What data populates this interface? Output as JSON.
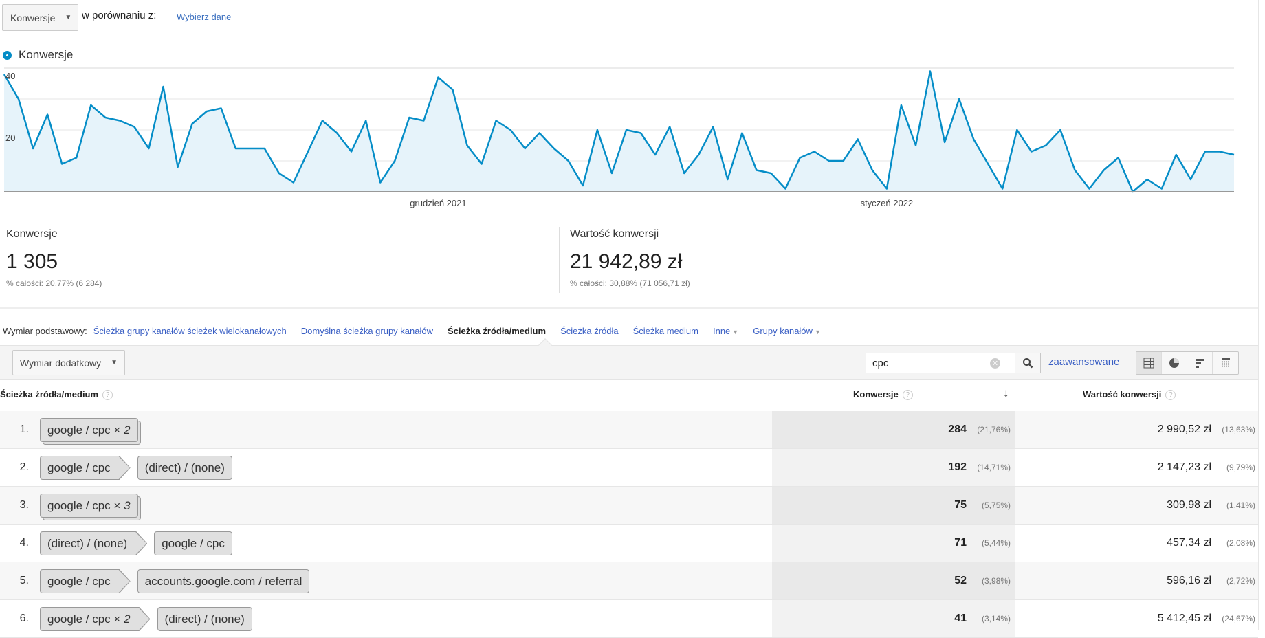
{
  "top": {
    "metric_dropdown": "Konwersje",
    "compare_label": "w porównaniu z:",
    "compare_link": "Wybierz dane"
  },
  "legend": {
    "label": "Konwersje",
    "color": "#058dc7"
  },
  "chart_data": {
    "type": "area",
    "series": [
      {
        "name": "Konwersje",
        "values": [
          38,
          30,
          14,
          25,
          9,
          11,
          28,
          24,
          23,
          21,
          14,
          34,
          8,
          22,
          26,
          27,
          14,
          14,
          14,
          6,
          3,
          13,
          23,
          19,
          13,
          23,
          3,
          10,
          24,
          23,
          37,
          33,
          15,
          9,
          23,
          20,
          14,
          19,
          14,
          10,
          2,
          20,
          6,
          20,
          19,
          12,
          21,
          6,
          12,
          21,
          4,
          19,
          7,
          6,
          1,
          11,
          13,
          10,
          10,
          17,
          7,
          1,
          28,
          15,
          39,
          16,
          30,
          17,
          9,
          1,
          20,
          13,
          15,
          20,
          7,
          1,
          7,
          11,
          0,
          4,
          1,
          12,
          4,
          13,
          13,
          12
        ]
      }
    ],
    "ylim": [
      0,
      40
    ],
    "yticks": [
      {
        "value": 40,
        "label": "40"
      },
      {
        "value": 20,
        "label": "20"
      }
    ],
    "xticks": [
      {
        "index": 30,
        "label": "grudzień 2021"
      },
      {
        "index": 61,
        "label": "styczeń 2022"
      }
    ],
    "grid": true,
    "line_color": "#058dc7",
    "fill_color": "#e6f3fa"
  },
  "summary": [
    {
      "label": "Konwersje",
      "value": "1 305",
      "pct": "% całości: 20,77% (6 284)"
    },
    {
      "label": "Wartość konwersji",
      "value": "21 942,89 zł",
      "pct": "% całości: 30,88% (71 056,71 zł)"
    }
  ],
  "dimensions": {
    "label": "Wymiar podstawowy:",
    "items": [
      {
        "label": "Ścieżka grupy kanałów ścieżek wielokanałowych"
      },
      {
        "label": "Domyślna ścieżka grupy kanałów"
      },
      {
        "label": "Ścieżka źródła/medium",
        "active": true
      },
      {
        "label": "Ścieżka źródła"
      },
      {
        "label": "Ścieżka medium"
      },
      {
        "label": "Inne",
        "dropdown": true
      },
      {
        "label": "Grupy kanałów",
        "dropdown": true
      }
    ]
  },
  "toolbar": {
    "secondary_dim": "Wymiar dodatkowy",
    "search_value": "cpc",
    "advanced": "zaawansowane"
  },
  "table": {
    "headers": {
      "path": "Ścieżka źródła/medium",
      "conv": "Konwersje",
      "value": "Wartość konwersji",
      "help": "?"
    },
    "rows": [
      {
        "n": "1.",
        "chips": [
          {
            "label": "google / cpc",
            "count": "2"
          }
        ],
        "conv": "284",
        "conv_pct": "(21,76%)",
        "value": "2 990,52 zł",
        "value_pct": "(13,63%)"
      },
      {
        "n": "2.",
        "chips": [
          {
            "label": "google / cpc"
          },
          {
            "label": "(direct) / (none)"
          }
        ],
        "conv": "192",
        "conv_pct": "(14,71%)",
        "value": "2 147,23 zł",
        "value_pct": "(9,79%)"
      },
      {
        "n": "3.",
        "chips": [
          {
            "label": "google / cpc",
            "count": "3"
          }
        ],
        "conv": "75",
        "conv_pct": "(5,75%)",
        "value": "309,98 zł",
        "value_pct": "(1,41%)"
      },
      {
        "n": "4.",
        "chips": [
          {
            "label": "(direct) / (none)"
          },
          {
            "label": "google / cpc"
          }
        ],
        "conv": "71",
        "conv_pct": "(5,44%)",
        "value": "457,34 zł",
        "value_pct": "(2,08%)"
      },
      {
        "n": "5.",
        "chips": [
          {
            "label": "google / cpc"
          },
          {
            "label": "accounts.google.com / referral"
          }
        ],
        "conv": "52",
        "conv_pct": "(3,98%)",
        "value": "596,16 zł",
        "value_pct": "(2,72%)"
      },
      {
        "n": "6.",
        "chips": [
          {
            "label": "google / cpc",
            "count": "2"
          },
          {
            "label": "(direct) / (none)"
          }
        ],
        "conv": "41",
        "conv_pct": "(3,14%)",
        "value": "5 412,45 zł",
        "value_pct": "(24,67%)"
      }
    ]
  }
}
